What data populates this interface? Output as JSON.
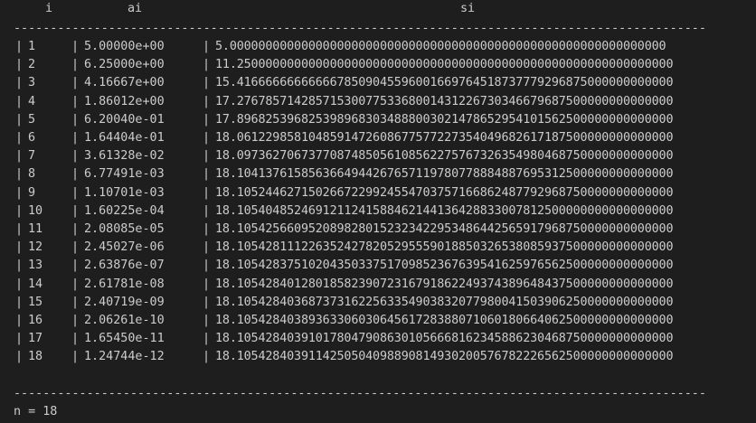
{
  "header": {
    "col_i": "i",
    "col_ai": "ai",
    "col_si": "si"
  },
  "separator": "-----------------------------------------------------------------------------------------------",
  "rows": [
    {
      "i": "1",
      "ai": "5.00000e+00",
      "si": "5.0000000000000000000000000000000000000000000000000000000000000"
    },
    {
      "i": "2",
      "ai": "6.25000e+00",
      "si": "11.2500000000000000000000000000000000000000000000000000000000000"
    },
    {
      "i": "3",
      "ai": "4.16667e+00",
      "si": "15.4166666666666678509045596001669764518737779296875000000000000"
    },
    {
      "i": "4",
      "ai": "1.86012e+00",
      "si": "17.2767857142857153007753368001431226730346679687500000000000000"
    },
    {
      "i": "5",
      "ai": "6.20040e-01",
      "si": "17.8968253968253989683034888003021478652954101562500000000000000"
    },
    {
      "i": "6",
      "ai": "1.64404e-01",
      "si": "18.0612298581048591472608677577227354049682617187500000000000000"
    },
    {
      "i": "7",
      "ai": "3.61328e-02",
      "si": "18.0973627067377087485056108562275767326354980468750000000000000"
    },
    {
      "i": "8",
      "ai": "6.77491e-03",
      "si": "18.1041376158563664944267657119780778884887695312500000000000000"
    },
    {
      "i": "9",
      "ai": "1.10701e-03",
      "si": "18.1052446271502667229924554703757166862487792968750000000000000"
    },
    {
      "i": "10",
      "ai": "1.60225e-04",
      "si": "18.1054048524691211241588462144136428833007812500000000000000000"
    },
    {
      "i": "11",
      "ai": "2.08085e-05",
      "si": "18.1054256609520898280152323422953486442565917968750000000000000"
    },
    {
      "i": "12",
      "ai": "2.45027e-06",
      "si": "18.1054281112263524278205295559018850326538085937500000000000000"
    },
    {
      "i": "13",
      "ai": "2.63876e-07",
      "si": "18.1054283751020435033751709852367639541625976562500000000000000"
    },
    {
      "i": "14",
      "ai": "2.61781e-08",
      "si": "18.1054284012801858239072316791862249374389648437500000000000000"
    },
    {
      "i": "15",
      "ai": "2.40719e-09",
      "si": "18.1054284036873731622563354903832077980041503906250000000000000"
    },
    {
      "i": "16",
      "ai": "2.06261e-10",
      "si": "18.1054284038936330603064561728388071060180664062500000000000000"
    },
    {
      "i": "17",
      "ai": "1.65450e-11",
      "si": "18.1054284039101780479086301056668162345886230468750000000000000"
    },
    {
      "i": "18",
      "ai": "1.24744e-12",
      "si": "18.1054284039114250504098890814930200576782226562500000000000000"
    }
  ],
  "footer": {
    "text": "n = 18"
  },
  "colors": {
    "background": "#1e1e1e",
    "foreground": "#cccccc"
  }
}
